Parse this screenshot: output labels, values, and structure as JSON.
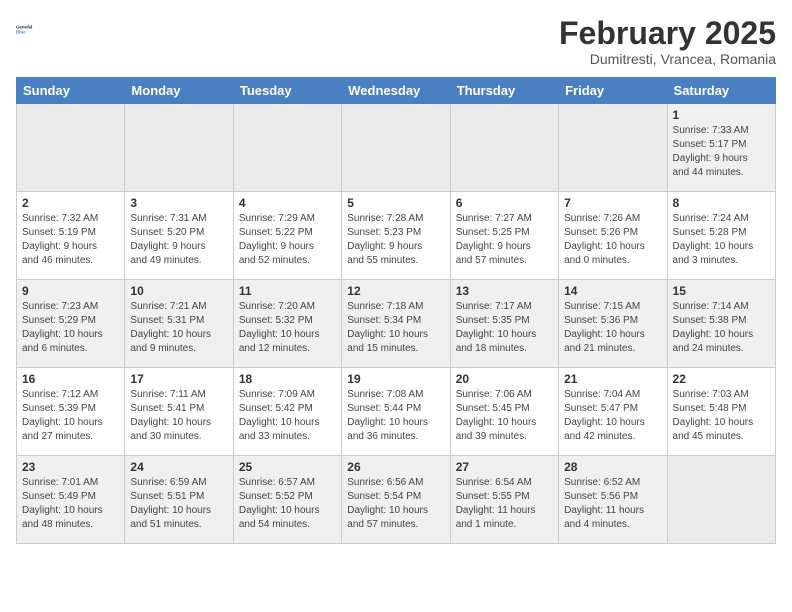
{
  "logo": {
    "general": "General",
    "blue": "Blue"
  },
  "title": "February 2025",
  "subtitle": "Dumitresti, Vrancea, Romania",
  "weekdays": [
    "Sunday",
    "Monday",
    "Tuesday",
    "Wednesday",
    "Thursday",
    "Friday",
    "Saturday"
  ],
  "weeks": [
    [
      {
        "day": "",
        "info": ""
      },
      {
        "day": "",
        "info": ""
      },
      {
        "day": "",
        "info": ""
      },
      {
        "day": "",
        "info": ""
      },
      {
        "day": "",
        "info": ""
      },
      {
        "day": "",
        "info": ""
      },
      {
        "day": "1",
        "info": "Sunrise: 7:33 AM\nSunset: 5:17 PM\nDaylight: 9 hours\nand 44 minutes."
      }
    ],
    [
      {
        "day": "2",
        "info": "Sunrise: 7:32 AM\nSunset: 5:19 PM\nDaylight: 9 hours\nand 46 minutes."
      },
      {
        "day": "3",
        "info": "Sunrise: 7:31 AM\nSunset: 5:20 PM\nDaylight: 9 hours\nand 49 minutes."
      },
      {
        "day": "4",
        "info": "Sunrise: 7:29 AM\nSunset: 5:22 PM\nDaylight: 9 hours\nand 52 minutes."
      },
      {
        "day": "5",
        "info": "Sunrise: 7:28 AM\nSunset: 5:23 PM\nDaylight: 9 hours\nand 55 minutes."
      },
      {
        "day": "6",
        "info": "Sunrise: 7:27 AM\nSunset: 5:25 PM\nDaylight: 9 hours\nand 57 minutes."
      },
      {
        "day": "7",
        "info": "Sunrise: 7:26 AM\nSunset: 5:26 PM\nDaylight: 10 hours\nand 0 minutes."
      },
      {
        "day": "8",
        "info": "Sunrise: 7:24 AM\nSunset: 5:28 PM\nDaylight: 10 hours\nand 3 minutes."
      }
    ],
    [
      {
        "day": "9",
        "info": "Sunrise: 7:23 AM\nSunset: 5:29 PM\nDaylight: 10 hours\nand 6 minutes."
      },
      {
        "day": "10",
        "info": "Sunrise: 7:21 AM\nSunset: 5:31 PM\nDaylight: 10 hours\nand 9 minutes."
      },
      {
        "day": "11",
        "info": "Sunrise: 7:20 AM\nSunset: 5:32 PM\nDaylight: 10 hours\nand 12 minutes."
      },
      {
        "day": "12",
        "info": "Sunrise: 7:18 AM\nSunset: 5:34 PM\nDaylight: 10 hours\nand 15 minutes."
      },
      {
        "day": "13",
        "info": "Sunrise: 7:17 AM\nSunset: 5:35 PM\nDaylight: 10 hours\nand 18 minutes."
      },
      {
        "day": "14",
        "info": "Sunrise: 7:15 AM\nSunset: 5:36 PM\nDaylight: 10 hours\nand 21 minutes."
      },
      {
        "day": "15",
        "info": "Sunrise: 7:14 AM\nSunset: 5:38 PM\nDaylight: 10 hours\nand 24 minutes."
      }
    ],
    [
      {
        "day": "16",
        "info": "Sunrise: 7:12 AM\nSunset: 5:39 PM\nDaylight: 10 hours\nand 27 minutes."
      },
      {
        "day": "17",
        "info": "Sunrise: 7:11 AM\nSunset: 5:41 PM\nDaylight: 10 hours\nand 30 minutes."
      },
      {
        "day": "18",
        "info": "Sunrise: 7:09 AM\nSunset: 5:42 PM\nDaylight: 10 hours\nand 33 minutes."
      },
      {
        "day": "19",
        "info": "Sunrise: 7:08 AM\nSunset: 5:44 PM\nDaylight: 10 hours\nand 36 minutes."
      },
      {
        "day": "20",
        "info": "Sunrise: 7:06 AM\nSunset: 5:45 PM\nDaylight: 10 hours\nand 39 minutes."
      },
      {
        "day": "21",
        "info": "Sunrise: 7:04 AM\nSunset: 5:47 PM\nDaylight: 10 hours\nand 42 minutes."
      },
      {
        "day": "22",
        "info": "Sunrise: 7:03 AM\nSunset: 5:48 PM\nDaylight: 10 hours\nand 45 minutes."
      }
    ],
    [
      {
        "day": "23",
        "info": "Sunrise: 7:01 AM\nSunset: 5:49 PM\nDaylight: 10 hours\nand 48 minutes."
      },
      {
        "day": "24",
        "info": "Sunrise: 6:59 AM\nSunset: 5:51 PM\nDaylight: 10 hours\nand 51 minutes."
      },
      {
        "day": "25",
        "info": "Sunrise: 6:57 AM\nSunset: 5:52 PM\nDaylight: 10 hours\nand 54 minutes."
      },
      {
        "day": "26",
        "info": "Sunrise: 6:56 AM\nSunset: 5:54 PM\nDaylight: 10 hours\nand 57 minutes."
      },
      {
        "day": "27",
        "info": "Sunrise: 6:54 AM\nSunset: 5:55 PM\nDaylight: 11 hours\nand 1 minute."
      },
      {
        "day": "28",
        "info": "Sunrise: 6:52 AM\nSunset: 5:56 PM\nDaylight: 11 hours\nand 4 minutes."
      },
      {
        "day": "",
        "info": ""
      }
    ]
  ]
}
